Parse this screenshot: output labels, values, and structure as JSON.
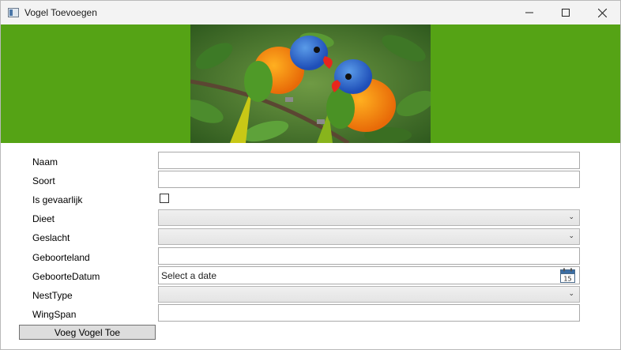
{
  "window": {
    "title": "Vogel Toevoegen",
    "icon": "app-window-icon"
  },
  "banner": {
    "background_color": "#55a315",
    "image": "parrots-photo"
  },
  "form": {
    "fields": {
      "naam": {
        "label": "Naam",
        "value": ""
      },
      "soort": {
        "label": "Soort",
        "value": ""
      },
      "gevaarlijk": {
        "label": "Is gevaarlijk",
        "checked": false
      },
      "dieet": {
        "label": "Dieet",
        "selected": ""
      },
      "geslacht": {
        "label": "Geslacht",
        "selected": ""
      },
      "geboorteland": {
        "label": "Geboorteland",
        "value": ""
      },
      "geboortedatum": {
        "label": "GeboorteDatum",
        "placeholder": "Select a date",
        "calendar_day": "15"
      },
      "nesttype": {
        "label": "NestType",
        "selected": ""
      },
      "wingspan": {
        "label": "WingSpan",
        "value": ""
      }
    },
    "submit_label": "Voeg Vogel Toe"
  }
}
